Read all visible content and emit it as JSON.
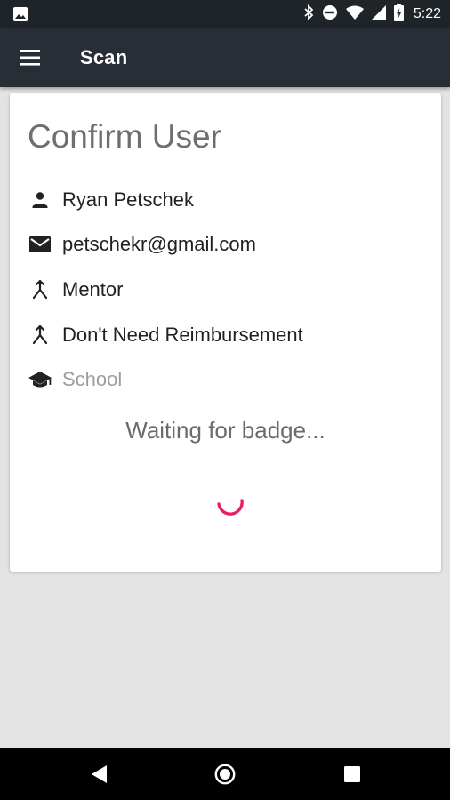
{
  "status_bar": {
    "time": "5:22",
    "icons": [
      "image-icon",
      "bluetooth-icon",
      "do-not-disturb-icon",
      "wifi-icon",
      "signal-icon",
      "battery-charging-icon"
    ]
  },
  "app_bar": {
    "menu_icon": "hamburger-menu-icon",
    "title": "Scan"
  },
  "card": {
    "title": "Confirm User",
    "details": [
      {
        "icon": "person-icon",
        "text": "Ryan Petschek"
      },
      {
        "icon": "email-icon",
        "text": "petschekr@gmail.com"
      },
      {
        "icon": "merge-icon",
        "text": "Mentor"
      },
      {
        "icon": "merge-icon",
        "text": "Don't Need Reimbursement"
      },
      {
        "icon": "school-icon",
        "text": "School"
      }
    ],
    "status_text": "Waiting for badge...",
    "spinner_color": "#e91e63"
  },
  "nav_bar": {
    "buttons": [
      "back-icon",
      "home-icon",
      "recents-icon"
    ]
  },
  "colors": {
    "status_bar": "#1f2429",
    "app_bar": "#272e35",
    "background": "#e3e3e3",
    "card": "#ffffff"
  }
}
